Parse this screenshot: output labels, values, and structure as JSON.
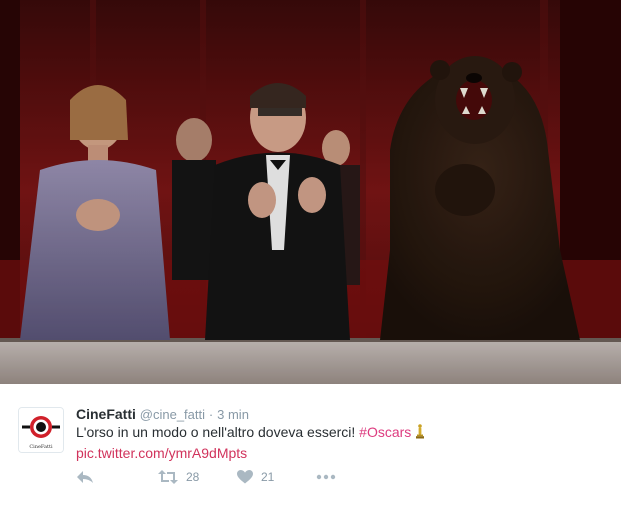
{
  "tweet": {
    "display_name": "CineFatti",
    "handle": "@cine_fatti",
    "separator": "·",
    "time": "3 min",
    "text": "L'orso in un modo o nell'altro doveva esserci!",
    "hashtag": "#Oscars",
    "link": "pic.twitter.com/ymrA9dMpts",
    "retweet_count": "28",
    "like_count": "21"
  },
  "avatar": {
    "logo_text": "CineFatti"
  },
  "icons": {
    "reply": "reply-icon",
    "retweet": "retweet-icon",
    "like": "heart-icon",
    "more": "more-icon",
    "oscar": "oscar-statuette-icon"
  },
  "colors": {
    "name": "#292f33",
    "meta": "#8899a6",
    "hashtag": "#dd3b7f",
    "link": "#d1335c",
    "action": "#aab8c2",
    "avatar_red": "#d0202a"
  }
}
